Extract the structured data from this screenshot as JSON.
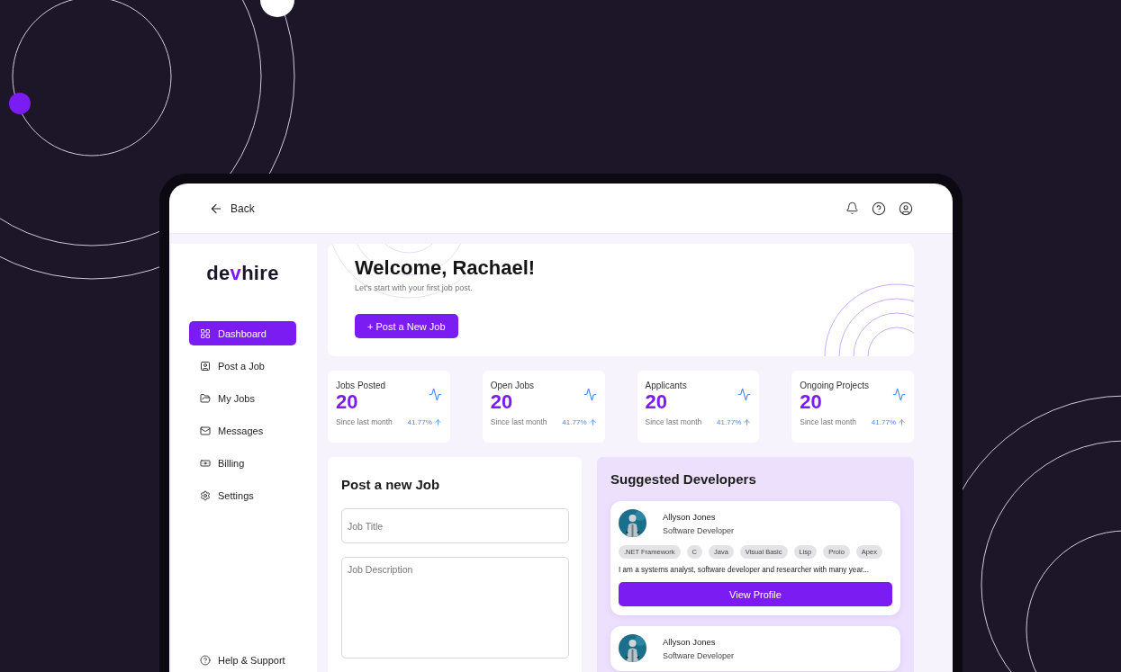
{
  "header": {
    "back": "Back"
  },
  "logo": {
    "parts": [
      {
        "text": "de",
        "accent": false
      },
      {
        "text": "v",
        "accent": true
      },
      {
        "text": "hire",
        "accent": false
      }
    ]
  },
  "sidebar": {
    "items": [
      {
        "label": "Dashboard",
        "selected": true
      },
      {
        "label": "Post a Job",
        "selected": false
      },
      {
        "label": "My Jobs",
        "selected": false
      },
      {
        "label": "Messages",
        "selected": false
      },
      {
        "label": "Billing",
        "selected": false
      },
      {
        "label": "Settings",
        "selected": false
      }
    ],
    "footer": "Help & Support"
  },
  "welcome": {
    "title": "Welcome, Rachael!",
    "subtitle": "Let's start with your first job post.",
    "button": "+ Post a New Job"
  },
  "stats": [
    {
      "label": "Jobs Posted",
      "value": "20",
      "period": "Since last month",
      "change": "41.77%"
    },
    {
      "label": "Open Jobs",
      "value": "20",
      "period": "Since last month",
      "change": "41.77%"
    },
    {
      "label": "Applicants",
      "value": "20",
      "period": "Since last month",
      "change": "41.77%"
    },
    {
      "label": "Ongoing Projects",
      "value": "20",
      "period": "Since last month",
      "change": "41.77%"
    }
  ],
  "post_job": {
    "title": "Post a new Job",
    "fields": [
      {
        "kind": "input",
        "placeholder": "Job Title"
      },
      {
        "kind": "textarea",
        "placeholder": "Job Description"
      }
    ]
  },
  "suggested": {
    "title": "Suggested Developers",
    "developers": [
      {
        "name": "Allyson Jones",
        "role": "Software Developer",
        "tags": [
          ".NET Framework",
          "C",
          "Java",
          "Visual Basic",
          "Lisp",
          "Prolo",
          "Apex"
        ],
        "bio": "I am a systems analyst, software developer and researcher with many year...",
        "button": "View Profile"
      },
      {
        "name": "Allyson Jones",
        "role": "Software Developer"
      }
    ]
  }
}
